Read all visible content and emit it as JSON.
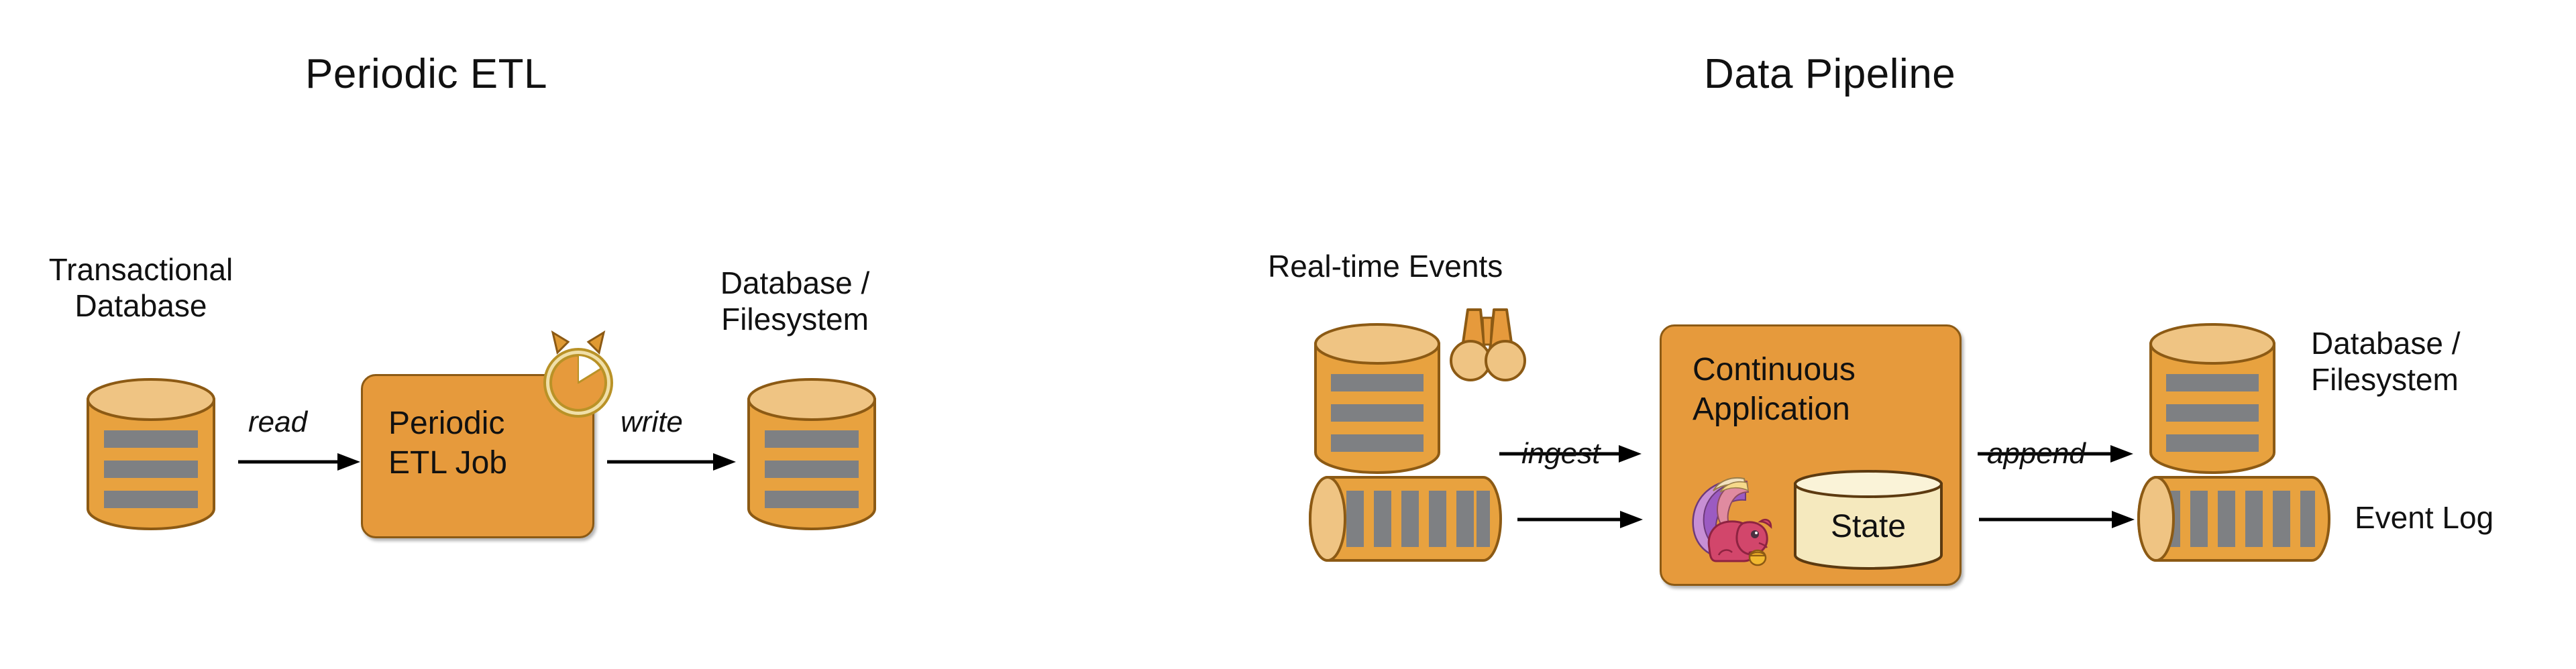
{
  "diagram": {
    "background_color": "#ffffff",
    "palette": {
      "body_orange": "#E8A23F",
      "box_orange": "#E69A3C",
      "cylinder_top_tan": "#EFC483",
      "outline_brown": "#8C5A14",
      "bar_gray": "#7E8083",
      "state_cream": "#F5E9BE",
      "clock_ring": "#F0DFA8",
      "text_black": "#111111",
      "flink_pink": "#D2466B",
      "flink_purple": "#9B5BC2"
    }
  },
  "panels": [
    {
      "id": "periodic-etl",
      "title": "Periodic ETL",
      "nodes": {
        "source_label": "Transactional\nDatabase",
        "process_label": "Periodic\nETL Job",
        "process_icon": "stopwatch-icon",
        "sink_label": "Database /\nFilesystem"
      },
      "edges": [
        {
          "id": "read",
          "label": "read",
          "from": "transactional-database",
          "to": "periodic-etl-job"
        },
        {
          "id": "write",
          "label": "write",
          "from": "periodic-etl-job",
          "to": "database-filesystem"
        }
      ]
    },
    {
      "id": "data-pipeline",
      "title": "Data Pipeline",
      "nodes": {
        "source_label": "Real-time Events",
        "source_icon": "binoculars-icon",
        "process_label": "Continuous\nApplication",
        "process_icon": "flink-squirrel-icon",
        "state_label": "State",
        "sink_db_label": "Database /\nFilesystem",
        "sink_log_label": "Event Log"
      },
      "edges": [
        {
          "id": "ingest-top",
          "label": "",
          "from": "events-database",
          "to": "continuous-application"
        },
        {
          "id": "ingest",
          "label": "ingest",
          "from": "events-log",
          "to": "continuous-application"
        },
        {
          "id": "append-top",
          "label": "",
          "from": "continuous-application",
          "to": "database-filesystem"
        },
        {
          "id": "append",
          "label": "append",
          "from": "continuous-application",
          "to": "event-log"
        }
      ]
    }
  ],
  "icons": {
    "stopwatch": "stopwatch-icon",
    "binoculars": "binoculars-icon",
    "squirrel": "flink-squirrel-icon",
    "database_cylinder": "database-cylinder-icon",
    "log_cylinder": "log-cylinder-icon",
    "state_cylinder": "state-cylinder-icon",
    "arrow": "arrow-right-icon"
  }
}
